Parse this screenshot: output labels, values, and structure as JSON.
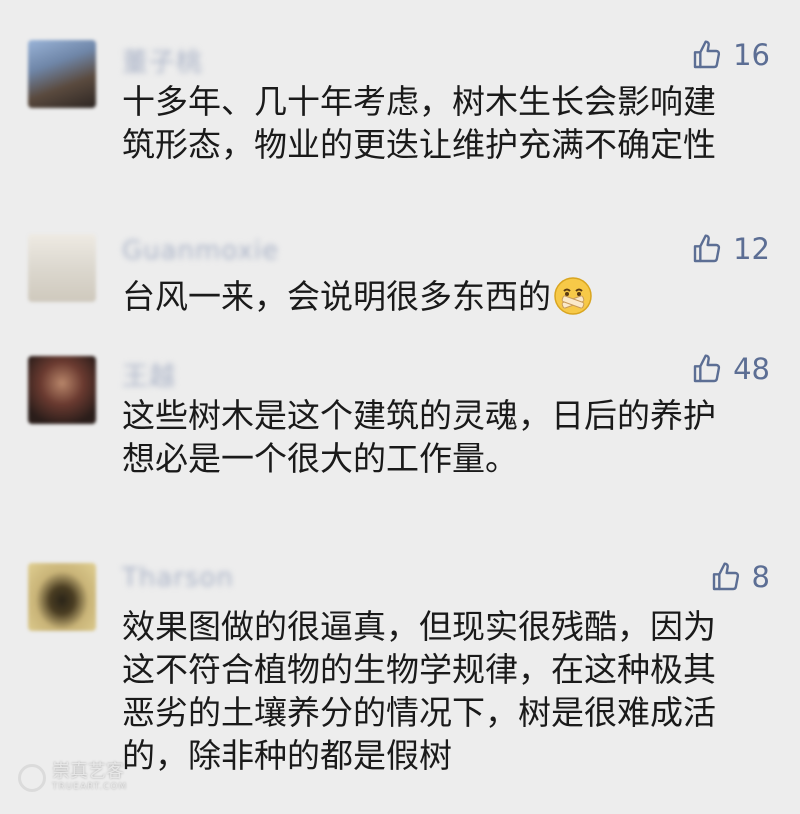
{
  "comments": [
    {
      "name": "董子桃",
      "likes": "16",
      "lines": [
        "十多年、几十年考虑，树木生长会影响建",
        "筑形态，物业的更迭让维护充满不确定性"
      ]
    },
    {
      "name": "Guanmoxie",
      "likes": "12",
      "lines": [
        "台风一来，会说明很多东西的"
      ],
      "emoji": "silenced-face-emoji"
    },
    {
      "name": "王越",
      "likes": "48",
      "lines": [
        "这些树木是这个建筑的灵魂，日后的养护",
        "想必是一个很大的工作量。"
      ]
    },
    {
      "name": "Tharson",
      "likes": "8",
      "lines": [
        "效果图做的很逼真，但现实很残酷，因为",
        "这不符合植物的生物学规律，在这种极其",
        "恶劣的土壤养分的情况下，树是很难成活",
        "的，除非种的都是假树"
      ]
    }
  ],
  "watermark": {
    "cn": "崇真艺客",
    "en": "TRUEART.COM"
  },
  "colors": {
    "background": "#ededed",
    "like": "#5c6e94",
    "text": "#1a1a1a"
  },
  "icons": {
    "like": "thumbs-up-icon"
  }
}
